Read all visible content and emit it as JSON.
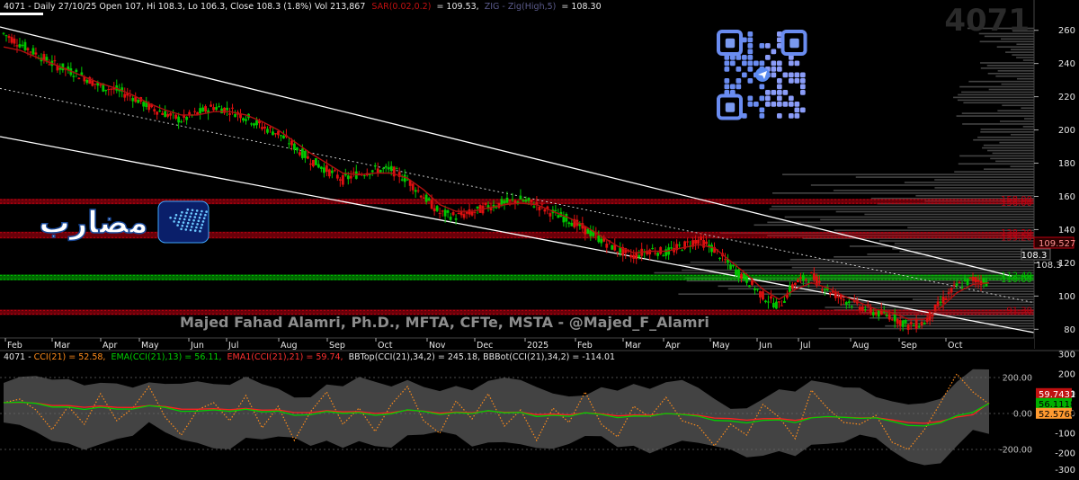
{
  "header": {
    "symbol": "4071",
    "info_text": "4071 - Daily 27/10/25 Open 107, Hi 108.3, Lo 106.3, Close 108.3 (1.8%) Vol 213,867",
    "sar_label": "SAR(0.02,0.2)",
    "sar_value": "= 109.53,",
    "zig_label": "ZIG - Zig(High,5)",
    "zig_value": "= 108.30",
    "watermark_symbol": "4071"
  },
  "watermark": {
    "author": "Majed Fahad Alamri, Ph.D., MFTA, CFTe, MSTA - @Majed_F_Alamri",
    "brand_arabic": "مضارب"
  },
  "colors": {
    "up_candle": "#00c800",
    "down_candle": "#e01010",
    "channel": "#ffffff",
    "resistance_red": "#c00010",
    "support_green": "#00c000",
    "volume_profile": "#7a7a7a",
    "cci": "#ff8c1a",
    "ema": "#00d000",
    "ema1": "#ff2020",
    "bb_band": "#5a5a5a"
  },
  "price_axis": {
    "ticks": [
      "260",
      "240",
      "220",
      "200",
      "180",
      "160",
      "140",
      "120",
      "100",
      "80"
    ],
    "last_price_tag": "108.3",
    "sar_tag": "109.527",
    "close_label": "108.3"
  },
  "levels": [
    {
      "upper": "158.00",
      "lower": "156.00",
      "color": "red"
    },
    {
      "upper": "138.20",
      "lower": "135.20",
      "color": "red"
    },
    {
      "upper": "112.40",
      "lower": "110.00",
      "color": "green"
    },
    {
      "upper": "91.30",
      "lower": "91.30",
      "color": "red"
    }
  ],
  "time_axis": [
    "Feb",
    "Mar",
    "Apr",
    "May",
    "Jun",
    "Jul",
    "Aug",
    "Sep",
    "Oct",
    "Nov",
    "Dec",
    "2025",
    "Feb",
    "Mar",
    "Apr",
    "May",
    "Jun",
    "Jul",
    "Aug",
    "Sep",
    "Oct"
  ],
  "cci_panel": {
    "info_prefix": "4071 - ",
    "cci_text": "CCI(21) = 52.58,",
    "ema_text": "EMA(CCI(21),13) = 56.11,",
    "ema1_text": "EMA1(CCI(21),21) = 59.74,",
    "bb_text": "BBTop(CCI(21),34,2) = 245.18, BBBot(CCI(21),34,2) = -114.01",
    "axis_ticks": [
      "300",
      "200",
      "100",
      "0.00",
      "-100",
      "-200",
      "-300"
    ],
    "inner_ticks": [
      "200.00",
      "0.00",
      "-200.00"
    ],
    "tags": {
      "ema1": "59.7431",
      "ema": "56.1118",
      "cci": "52.5768"
    }
  },
  "chart_data": {
    "type": "line",
    "title": "4071 - Daily 27/10/25",
    "ylim": [
      70,
      275
    ],
    "y_scale": "linear",
    "grid": false,
    "x_labels": [
      "Feb",
      "Mar",
      "Apr",
      "May",
      "Jun",
      "Jul",
      "Aug",
      "Sep",
      "Oct",
      "Nov",
      "Dec",
      "2025",
      "Feb",
      "Mar",
      "Apr",
      "May",
      "Jun",
      "Jul",
      "Aug",
      "Sep",
      "Oct"
    ],
    "series": [
      {
        "name": "4071",
        "values": [
          258,
          252,
          246,
          240,
          236,
          232,
          226,
          224,
          220,
          214,
          210,
          206,
          210,
          214,
          212,
          208,
          202,
          198,
          190,
          182,
          176,
          170,
          174,
          176,
          176,
          170,
          160,
          150,
          148,
          150,
          154,
          156,
          158,
          155,
          150,
          146,
          140,
          134,
          128,
          124,
          128,
          126,
          130,
          134,
          128,
          118,
          110,
          100,
          94,
          108,
          112,
          104,
          98,
          94,
          90,
          88,
          82,
          84,
          96,
          106,
          110,
          108.3
        ]
      },
      {
        "name": "EMA",
        "values": [
          250,
          248,
          244,
          240,
          236,
          232,
          228,
          225,
          221,
          216,
          212,
          209,
          209,
          211,
          211,
          209,
          205,
          200,
          193,
          186,
          180,
          174,
          173,
          174,
          174,
          171,
          164,
          155,
          151,
          151,
          153,
          155,
          156,
          155,
          151,
          147,
          142,
          136,
          130,
          126,
          127,
          127,
          129,
          131,
          129,
          121,
          113,
          104,
          98,
          104,
          108,
          105,
          100,
          96,
          92,
          90,
          86,
          86,
          93,
          102,
          107,
          108
        ]
      }
    ],
    "annotations": [
      "158.00",
      "156.00",
      "138.20",
      "135.20",
      "112.40",
      "110.00",
      "91.30",
      "108.3",
      "109.527"
    ],
    "cci": {
      "ylim": [
        -300,
        300
      ],
      "cci_values": [
        60,
        80,
        20,
        -90,
        40,
        -60,
        110,
        -40,
        30,
        150,
        -20,
        -120,
        20,
        60,
        -40,
        100,
        -80,
        40,
        -150,
        10,
        120,
        -60,
        30,
        -100,
        50,
        150,
        -40,
        -110,
        70,
        -30,
        110,
        -70,
        20,
        -150,
        30,
        -50,
        120,
        -60,
        -130,
        40,
        -20,
        90,
        -40,
        -70,
        -180,
        -60,
        -120,
        50,
        -20,
        -140,
        130,
        30,
        -50,
        -60,
        -10,
        -160,
        -200,
        -90,
        60,
        220,
        120,
        52.58
      ],
      "ema_value": 56.11,
      "ema1_value": 59.74,
      "bb_top": 245.18,
      "bb_bottom": -114.01
    }
  }
}
